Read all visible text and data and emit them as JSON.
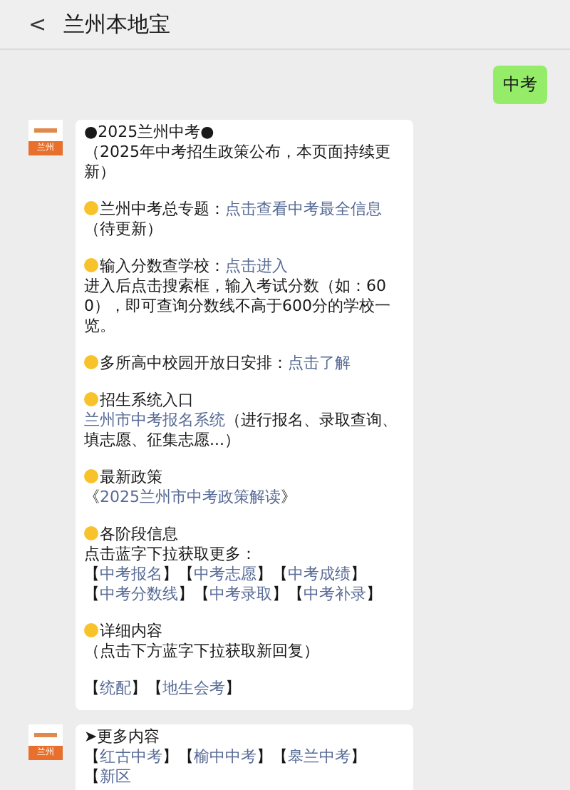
{
  "header": {
    "back": "<",
    "title": "兰州本地宝"
  },
  "messages": [
    {
      "kind": "sent",
      "text": "中考"
    },
    {
      "kind": "received",
      "avatar": "兰州",
      "paragraphs": [
        [
          {
            "kind": "text",
            "text": "●2025兰州中考●"
          },
          {
            "kind": "break"
          },
          {
            "kind": "text",
            "text": "（2025年中考招生政策公布，本页面持续更新）"
          }
        ],
        [
          {
            "kind": "dot"
          },
          {
            "kind": "text",
            "text": "兰州中考总专题："
          },
          {
            "kind": "link",
            "text": "点击查看中考最全信息"
          },
          {
            "kind": "text",
            "text": "（待更新）"
          }
        ],
        [
          {
            "kind": "dot"
          },
          {
            "kind": "text",
            "text": "输入分数查学校："
          },
          {
            "kind": "link",
            "text": "点击进入"
          },
          {
            "kind": "break"
          },
          {
            "kind": "text",
            "text": "进入后点击搜索框，输入考试分数（如：600），即可查询分数线不高于600分的学校一览。"
          }
        ],
        [
          {
            "kind": "dot"
          },
          {
            "kind": "text",
            "text": "多所高中校园开放日安排："
          },
          {
            "kind": "link",
            "text": "点击了解"
          }
        ],
        [
          {
            "kind": "dot"
          },
          {
            "kind": "text",
            "text": "招生系统入口"
          },
          {
            "kind": "break"
          },
          {
            "kind": "link",
            "text": "兰州市中考报名系统"
          },
          {
            "kind": "text",
            "text": "（进行报名、录取查询、填志愿、征集志愿...）"
          }
        ],
        [
          {
            "kind": "dot"
          },
          {
            "kind": "text",
            "text": "最新政策"
          },
          {
            "kind": "break"
          },
          {
            "kind": "text",
            "text": "《"
          },
          {
            "kind": "link",
            "text": "2025兰州市中考政策解读"
          },
          {
            "kind": "text",
            "text": "》"
          }
        ],
        [
          {
            "kind": "dot"
          },
          {
            "kind": "text",
            "text": "各阶段信息"
          },
          {
            "kind": "break"
          },
          {
            "kind": "text",
            "text": "点击蓝字下拉获取更多："
          },
          {
            "kind": "break"
          },
          {
            "kind": "text",
            "text": "【"
          },
          {
            "kind": "link",
            "text": "中考报名"
          },
          {
            "kind": "text",
            "text": "】【"
          },
          {
            "kind": "link",
            "text": "中考志愿"
          },
          {
            "kind": "text",
            "text": "】【"
          },
          {
            "kind": "link",
            "text": "中考成绩"
          },
          {
            "kind": "text",
            "text": "】【"
          },
          {
            "kind": "link",
            "text": "中考分数线"
          },
          {
            "kind": "text",
            "text": "】【"
          },
          {
            "kind": "link",
            "text": "中考录取"
          },
          {
            "kind": "text",
            "text": "】【"
          },
          {
            "kind": "link",
            "text": "中考补录"
          },
          {
            "kind": "text",
            "text": "】"
          }
        ],
        [
          {
            "kind": "dot"
          },
          {
            "kind": "text",
            "text": "详细内容"
          },
          {
            "kind": "break"
          },
          {
            "kind": "text",
            "text": "（点击下方蓝字下拉获取新回复）"
          }
        ],
        [
          {
            "kind": "text",
            "text": "【"
          },
          {
            "kind": "link",
            "text": "统配"
          },
          {
            "kind": "text",
            "text": "】【"
          },
          {
            "kind": "link",
            "text": "地生会考"
          },
          {
            "kind": "text",
            "text": "】"
          }
        ]
      ]
    },
    {
      "kind": "received",
      "avatar": "兰州",
      "paragraphs": [
        [
          {
            "kind": "text",
            "text": "➤更多内容"
          },
          {
            "kind": "break"
          },
          {
            "kind": "text",
            "text": "【"
          },
          {
            "kind": "link",
            "text": "红古中考"
          },
          {
            "kind": "text",
            "text": "】【"
          },
          {
            "kind": "link",
            "text": "榆中中考"
          },
          {
            "kind": "text",
            "text": "】【"
          },
          {
            "kind": "link",
            "text": "皋兰中考"
          },
          {
            "kind": "text",
            "text": "】【"
          },
          {
            "kind": "link",
            "text": "新区"
          }
        ]
      ]
    }
  ]
}
